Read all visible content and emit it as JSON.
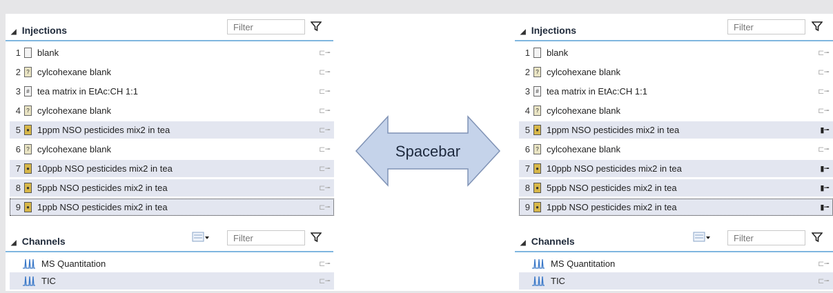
{
  "left": {
    "injections": {
      "title": "Injections",
      "filter_placeholder": "Filter",
      "rows": [
        {
          "num": "1",
          "name": "blank",
          "vial": "blank",
          "selected": false,
          "focused": false,
          "plug_on": false
        },
        {
          "num": "2",
          "name": "cylcohexane blank",
          "vial": "q",
          "selected": false,
          "focused": false,
          "plug_on": false
        },
        {
          "num": "3",
          "name": "tea matrix in EtAc:CH 1:1",
          "vial": "m",
          "selected": false,
          "focused": false,
          "plug_on": false
        },
        {
          "num": "4",
          "name": "cylcohexane blank",
          "vial": "q",
          "selected": false,
          "focused": false,
          "plug_on": false
        },
        {
          "num": "5",
          "name": "1ppm NSO pesticides mix2 in tea",
          "vial": "std",
          "selected": true,
          "focused": false,
          "plug_on": false
        },
        {
          "num": "6",
          "name": "cylcohexane blank",
          "vial": "q",
          "selected": false,
          "focused": false,
          "plug_on": false
        },
        {
          "num": "7",
          "name": "10ppb NSO pesticides mix2 in tea",
          "vial": "std",
          "selected": true,
          "focused": false,
          "plug_on": false
        },
        {
          "num": "8",
          "name": "5ppb NSO pesticides mix2 in tea",
          "vial": "std",
          "selected": true,
          "focused": false,
          "plug_on": false
        },
        {
          "num": "9",
          "name": "1ppb NSO pesticides mix2 in tea",
          "vial": "std",
          "selected": true,
          "focused": true,
          "plug_on": false
        }
      ]
    },
    "channels": {
      "title": "Channels",
      "filter_placeholder": "Filter",
      "rows": [
        {
          "name": "MS Quantitation",
          "selected": false
        },
        {
          "name": "TIC",
          "selected": true
        }
      ]
    }
  },
  "right": {
    "injections": {
      "title": "Injections",
      "filter_placeholder": "Filter",
      "rows": [
        {
          "num": "1",
          "name": "blank",
          "vial": "blank",
          "selected": false,
          "focused": false,
          "plug_on": false
        },
        {
          "num": "2",
          "name": "cylcohexane blank",
          "vial": "q",
          "selected": false,
          "focused": false,
          "plug_on": false
        },
        {
          "num": "3",
          "name": "tea matrix in EtAc:CH 1:1",
          "vial": "m",
          "selected": false,
          "focused": false,
          "plug_on": false
        },
        {
          "num": "4",
          "name": "cylcohexane blank",
          "vial": "q",
          "selected": false,
          "focused": false,
          "plug_on": false
        },
        {
          "num": "5",
          "name": "1ppm NSO pesticides mix2 in tea",
          "vial": "std",
          "selected": true,
          "focused": false,
          "plug_on": true
        },
        {
          "num": "6",
          "name": "cylcohexane blank",
          "vial": "q",
          "selected": false,
          "focused": false,
          "plug_on": false
        },
        {
          "num": "7",
          "name": "10ppb NSO pesticides mix2 in tea",
          "vial": "std",
          "selected": true,
          "focused": false,
          "plug_on": true
        },
        {
          "num": "8",
          "name": "5ppb NSO pesticides mix2 in tea",
          "vial": "std",
          "selected": true,
          "focused": false,
          "plug_on": true
        },
        {
          "num": "9",
          "name": "1ppb NSO pesticides mix2 in tea",
          "vial": "std",
          "selected": true,
          "focused": true,
          "plug_on": true
        }
      ]
    },
    "channels": {
      "title": "Channels",
      "filter_placeholder": "Filter",
      "rows": [
        {
          "name": "MS Quantitation",
          "selected": false
        },
        {
          "name": "TIC",
          "selected": true
        }
      ]
    }
  },
  "arrow": {
    "label": "Spacebar",
    "fill": "#c5d3ea",
    "stroke": "#7f92b5"
  },
  "icons": {
    "collapse": "collapse-triangle-icon",
    "filter": "funnel-icon",
    "plug": "plug-icon",
    "chromatogram": "chromatogram-icon",
    "list_options": "list-options-icon"
  },
  "colors": {
    "accent_line": "#7fb6df",
    "selected_row": "#e3e6f0",
    "chromatogram": "#3a78c8"
  }
}
